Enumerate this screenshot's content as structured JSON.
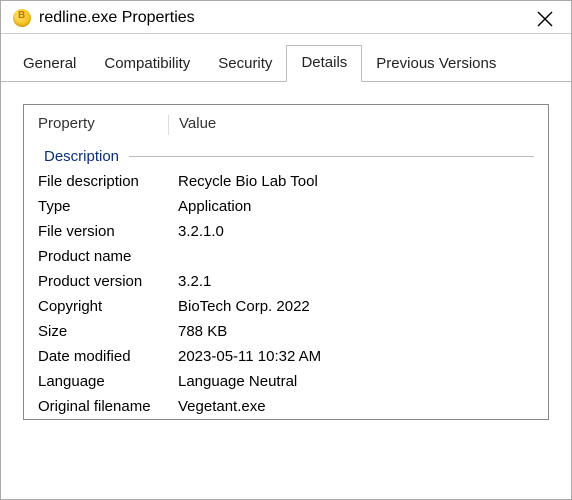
{
  "window": {
    "title": "redline.exe Properties"
  },
  "tabs": [
    {
      "label": "General"
    },
    {
      "label": "Compatibility"
    },
    {
      "label": "Security"
    },
    {
      "label": "Details",
      "active": true
    },
    {
      "label": "Previous Versions"
    }
  ],
  "details": {
    "headers": {
      "property": "Property",
      "value": "Value"
    },
    "section_title": "Description",
    "rows": [
      {
        "label": "File description",
        "value": "Recycle Bio Lab Tool"
      },
      {
        "label": "Type",
        "value": "Application"
      },
      {
        "label": "File version",
        "value": "3.2.1.0"
      },
      {
        "label": "Product name",
        "value": ""
      },
      {
        "label": "Product version",
        "value": "3.2.1"
      },
      {
        "label": "Copyright",
        "value": "BioTech Corp. 2022"
      },
      {
        "label": "Size",
        "value": "788 KB"
      },
      {
        "label": "Date modified",
        "value": "2023-05-11 10:32 AM"
      },
      {
        "label": "Language",
        "value": "Language Neutral"
      },
      {
        "label": "Original filename",
        "value": "Vegetant.exe"
      }
    ]
  }
}
